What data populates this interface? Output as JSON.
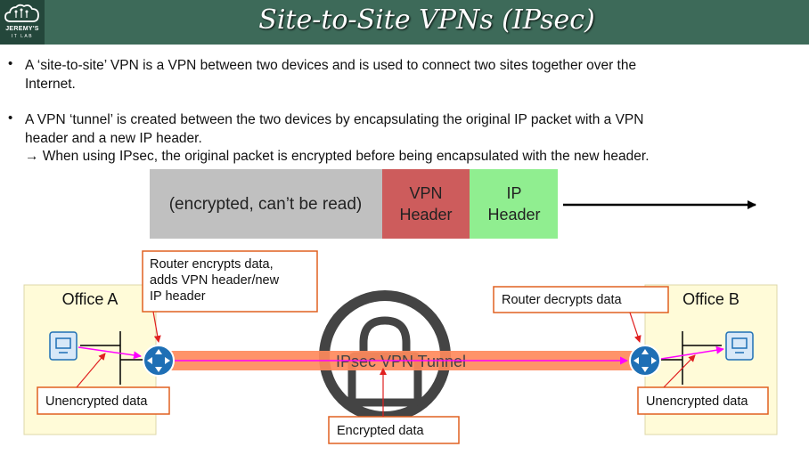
{
  "header": {
    "title": "Site-to-Site VPNs (IPsec)",
    "logo_line1": "JEREMY'S",
    "logo_line2": "IT LAB"
  },
  "bullets": [
    {
      "line1": "A ‘site-to-site’ VPN is a VPN between two devices and is used to connect two sites together over the",
      "line2": "Internet."
    },
    {
      "line1": "A VPN ‘tunnel’ is created between the two devices by encapsulating the original IP packet with a VPN",
      "line2": "header and a new IP header.",
      "line3": "→ When using IPsec, the original packet is encrypted before being encapsulated with the new header."
    }
  ],
  "packet": {
    "payload": "(encrypted, can’t be read)",
    "vpn_header_line1": "VPN",
    "vpn_header_line2": "Header",
    "ip_header_line1": "IP",
    "ip_header_line2": "Header"
  },
  "sites": {
    "office_a": "Office A",
    "office_b": "Office B"
  },
  "tunnel_label": "IPsec VPN Tunnel",
  "callouts": {
    "router_encrypts_line1": "Router encrypts data,",
    "router_encrypts_line2": "adds VPN header/new",
    "router_encrypts_line3": "IP header",
    "router_decrypts": "Router decrypts data",
    "unencrypted_left": "Unencrypted data",
    "unencrypted_right": "Unencrypted data",
    "encrypted": "Encrypted data"
  },
  "colors": {
    "title_bar": "#3d6a59",
    "office_fill": "#fffbd8",
    "tunnel": "#ff8a5c",
    "callout_border": "#e06020",
    "payload_fill": "#c0c0c0",
    "vpn_header_fill": "#cd5c5c",
    "ip_header_fill": "#90ee90",
    "router": "#1e6fb5",
    "flow_arrow": "#ff00ff"
  }
}
